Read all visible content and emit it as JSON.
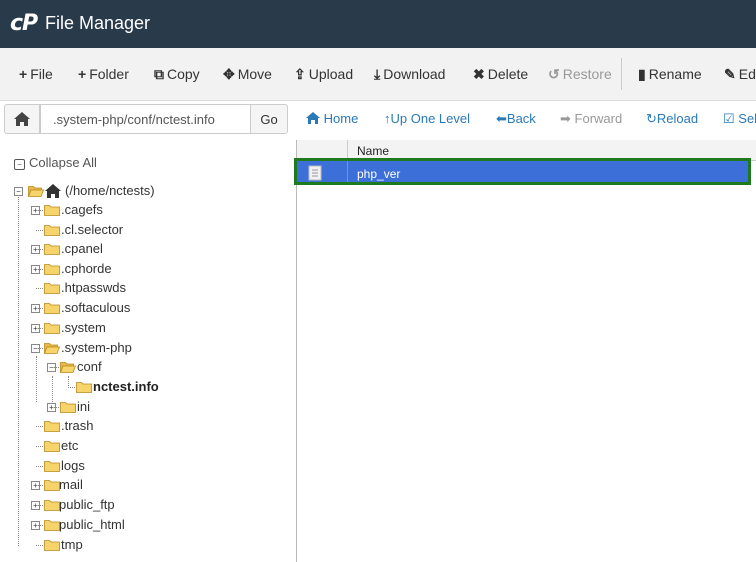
{
  "header": {
    "logo": "cP",
    "title": "File Manager"
  },
  "toolbar": {
    "file": "File",
    "folder": "Folder",
    "copy": "Copy",
    "move": "Move",
    "upload": "Upload",
    "download": "Download",
    "delete": "Delete",
    "restore": "Restore",
    "rename": "Rename",
    "edit": "Edi"
  },
  "pathbar": {
    "path_value": ".system-php/conf/nctest.info",
    "go": "Go"
  },
  "nav": {
    "home": "Home",
    "up": "Up One Level",
    "back": "Back",
    "forward": "Forward",
    "reload": "Reload",
    "select": "Sel"
  },
  "tree": {
    "collapse_all": "Collapse All",
    "root": "(/home/nctests)",
    "items": {
      "cagefs": ".cagefs",
      "cl_selector": ".cl.selector",
      "cpanel": ".cpanel",
      "cphorde": ".cphorde",
      "htpasswds": ".htpasswds",
      "softaculous": ".softaculous",
      "system": ".system",
      "system_php": ".system-php",
      "conf": "conf",
      "nctest_info": "nctest.info",
      "ini": "ini",
      "trash": ".trash",
      "etc": "etc",
      "logs": "logs",
      "mail": "mail",
      "public_ftp": "public_ftp",
      "public_html": "public_html",
      "tmp": "tmp"
    }
  },
  "filelist": {
    "columns": {
      "name": "Name"
    },
    "rows": [
      {
        "name": "php_ver"
      }
    ]
  },
  "colors": {
    "header_bg": "#293a4a",
    "selected_row": "#3d6fd8",
    "highlight_outline": "#1f7a1f",
    "link": "#2a7ab8"
  }
}
